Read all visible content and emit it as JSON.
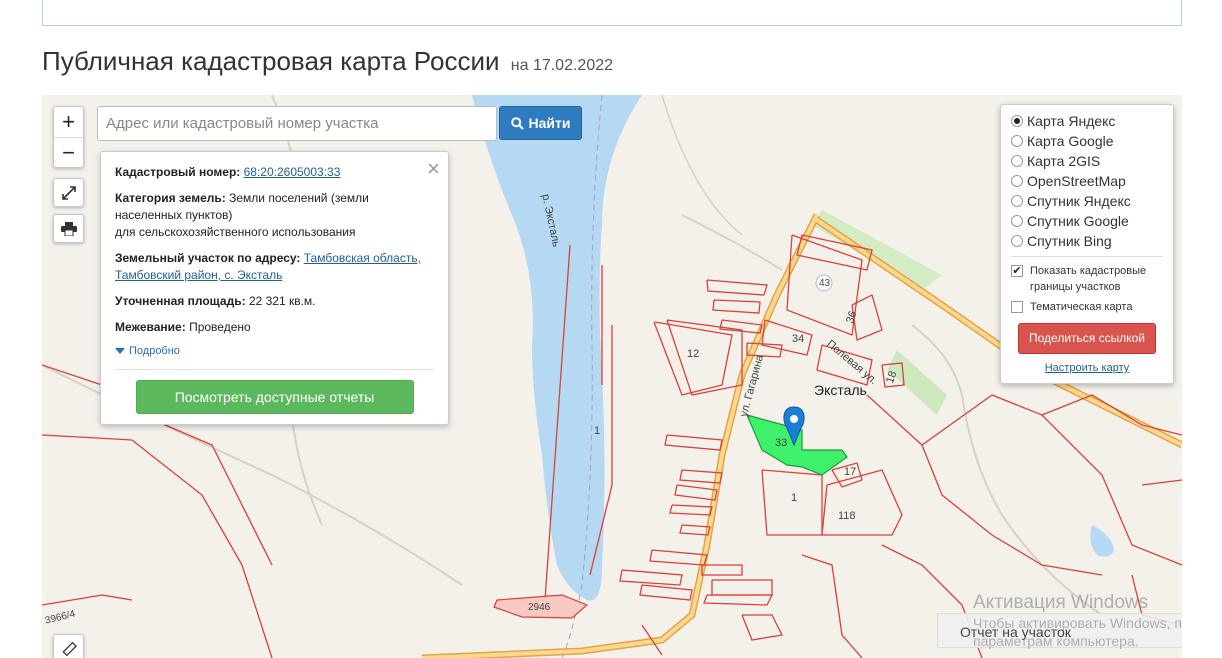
{
  "page": {
    "title": "Публичная кадастровая карта России",
    "date_prefix": "на",
    "date": "17.02.2022"
  },
  "map_controls": {
    "zoom_in": "+",
    "zoom_out": "−",
    "fullscreen_icon": "expand-icon",
    "print_icon": "printer-icon",
    "ruler_icon": "ruler-icon"
  },
  "search": {
    "placeholder": "Адрес или кадастровый номер участка",
    "button_label": "Найти",
    "button_icon": "search-icon"
  },
  "info_card": {
    "cadastral_label": "Кадастровый номер:",
    "cadastral_number": "68:20:2605003:33",
    "category_label": "Категория земель:",
    "category_value": "Земли поселений (земли населенных пунктов)",
    "category_usage": "для сельскохозяйственного использования",
    "address_label": "Земельный участок по адресу:",
    "address_value": "Тамбовская область, Тамбовский район, с. Эксталь",
    "area_label": "Уточненная площадь:",
    "area_value": "22 321 кв.м.",
    "survey_label": "Межевание:",
    "survey_value": "Проведено",
    "more_link": "Подробно",
    "reports_button": "Посмотреть доступные отчеты",
    "close_glyph": "×"
  },
  "layers": {
    "options": [
      {
        "label": "Карта Яндекс",
        "selected": true
      },
      {
        "label": "Карта Google",
        "selected": false
      },
      {
        "label": "Карта 2GIS",
        "selected": false
      },
      {
        "label": "OpenStreetMap",
        "selected": false
      },
      {
        "label": "Спутник Яндекс",
        "selected": false
      },
      {
        "label": "Спутник Google",
        "selected": false
      },
      {
        "label": "Спутник Bing",
        "selected": false
      }
    ],
    "show_borders_label": "Показать кадастровые границы участков",
    "show_borders_checked": true,
    "thematic_label": "Тематическая карта",
    "thematic_checked": false,
    "share_button": "Поделиться ссылкой",
    "configure_link": "Настроить карту"
  },
  "map_labels": {
    "river": "р. Эксталь",
    "street_gagarina": "ул. Гагарина",
    "street_polevaya": "Полевая ул.",
    "village": "Эксталь",
    "road_number": "43",
    "parcel_12": "12",
    "parcel_34": "34",
    "parcel_36": "36",
    "parcel_18": "18",
    "parcel_33": "33",
    "parcel_17": "17",
    "parcel_1a": "1",
    "parcel_1b": "1",
    "parcel_118": "118",
    "parcel_2946": "2946",
    "parcel_3966": "3966/4"
  },
  "report_bar": {
    "label": "Отчет на участок"
  },
  "watermark": {
    "title": "Активация Windows",
    "line1": "Чтобы активировать Windows, пере",
    "line2": "параметрам компьютера."
  },
  "colors": {
    "water": "#b5d9f2",
    "parcel_border": "#d9413a",
    "selected_parcel": "#3ef06a",
    "road": "#f5c26b",
    "search_button": "#2f7bbf",
    "reports_button": "#5cb85c",
    "share_button": "#d9534f",
    "marker": "#1d7ed6"
  }
}
